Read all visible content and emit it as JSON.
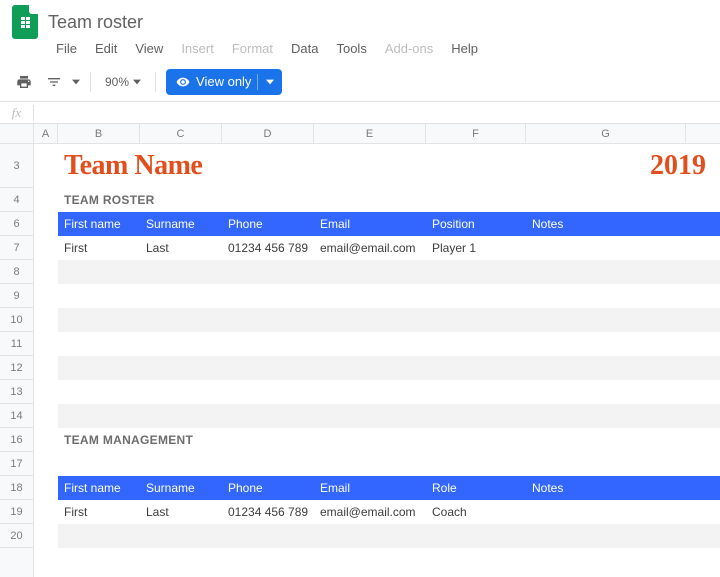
{
  "doc": {
    "title": "Team roster"
  },
  "menu": {
    "file": "File",
    "edit": "Edit",
    "view": "View",
    "insert": "Insert",
    "format": "Format",
    "data": "Data",
    "tools": "Tools",
    "addons": "Add-ons",
    "help": "Help"
  },
  "toolbar": {
    "zoom": "90%",
    "view_only": "View only"
  },
  "formula": {
    "fx": "fx"
  },
  "cols": {
    "A": "A",
    "B": "B",
    "C": "C",
    "D": "D",
    "E": "E",
    "F": "F",
    "G": "G"
  },
  "rows": {
    "r3": "3",
    "r4": "4",
    "r6": "6",
    "r7": "7",
    "r8": "8",
    "r9": "9",
    "r10": "10",
    "r11": "11",
    "r12": "12",
    "r13": "13",
    "r14": "14",
    "r16": "16",
    "r17": "17",
    "r18": "18",
    "r19": "19",
    "r20": "20"
  },
  "content": {
    "team_name": "Team Name",
    "year": "2019",
    "roster_label": "TEAM ROSTER",
    "management_label": "TEAM MANAGEMENT"
  },
  "roster_headers": {
    "first": "First name",
    "surname": "Surname",
    "phone": "Phone",
    "email": "Email",
    "position": "Position",
    "notes": "Notes"
  },
  "roster_row": {
    "first": "First",
    "surname": "Last",
    "phone": "01234 456 789",
    "email": "email@email.com",
    "position": "Player 1",
    "notes": ""
  },
  "mgmt_headers": {
    "first": "First name",
    "surname": "Surname",
    "phone": "Phone",
    "email": "Email",
    "role": "Role",
    "notes": "Notes"
  },
  "mgmt_row": {
    "first": "First",
    "surname": "Last",
    "phone": "01234 456 789",
    "email": "email@email.com",
    "role": "Coach",
    "notes": ""
  }
}
